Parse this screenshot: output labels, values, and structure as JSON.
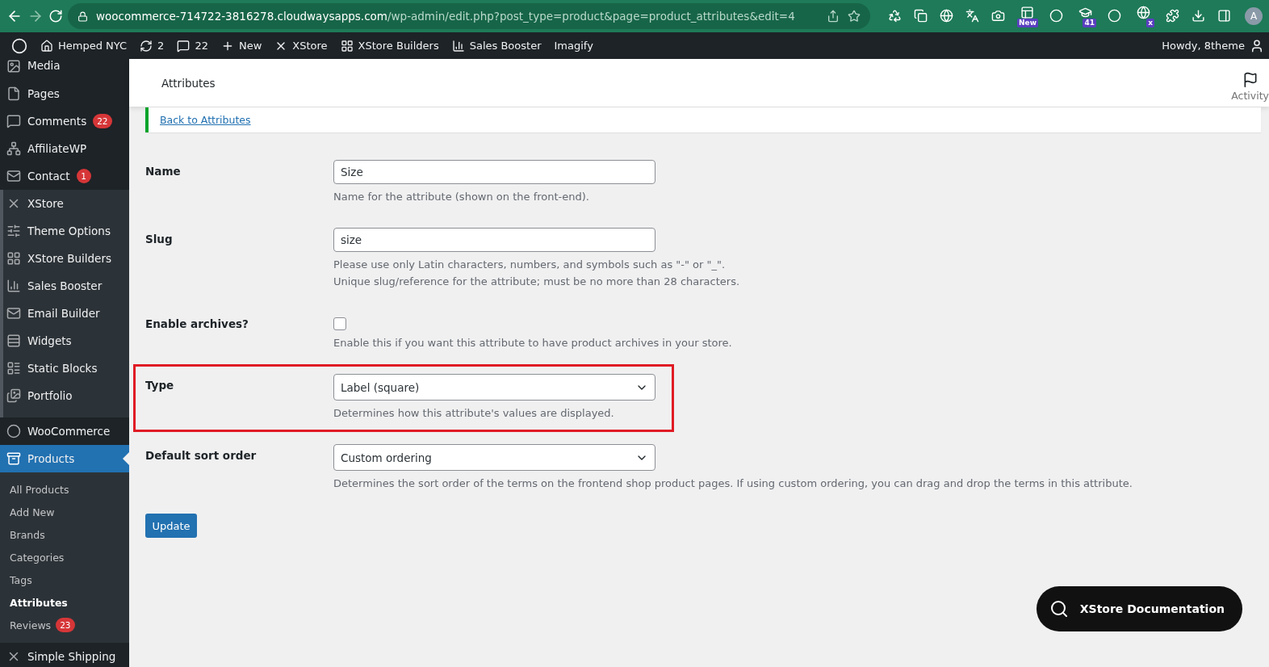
{
  "browser": {
    "url_host": "woocommerce-714722-3816278.cloudwaysapps.com",
    "url_path": "/wp-admin/edit.php?post_type=product&page=product_attributes&edit=4",
    "extensions": [
      {
        "kind": "plain"
      },
      {
        "kind": "plain"
      },
      {
        "kind": "plain"
      },
      {
        "kind": "plain"
      },
      {
        "kind": "plain"
      },
      {
        "kind": "badge",
        "badge": "New"
      },
      {
        "kind": "plain"
      },
      {
        "kind": "badge",
        "badge": "41"
      },
      {
        "kind": "plain"
      },
      {
        "kind": "badge",
        "badge": "x"
      },
      {
        "kind": "plain"
      },
      {
        "kind": "plain"
      },
      {
        "kind": "plain"
      }
    ],
    "profile": "A"
  },
  "admin_bar": {
    "items": [
      {
        "label": "Hemped NYC"
      },
      {
        "label": "2"
      },
      {
        "label": "22"
      },
      {
        "label": "New"
      },
      {
        "label": "XStore"
      },
      {
        "label": "XStore Builders"
      },
      {
        "label": "Sales Booster"
      },
      {
        "label": "Imagify"
      }
    ],
    "greeting": "Howdy, 8theme"
  },
  "sidebar": {
    "groups": [
      {
        "kind": "core",
        "items": [
          {
            "label": "Media",
            "selected": false
          },
          {
            "label": "Pages",
            "selected": false
          },
          {
            "label": "Comments",
            "badge": "22",
            "selected": false
          },
          {
            "label": "AffiliateWP",
            "selected": false
          },
          {
            "label": "Contact",
            "badge": "1",
            "selected": false
          }
        ]
      },
      {
        "kind": "plugin",
        "items": [
          {
            "label": "XStore",
            "selected": false
          },
          {
            "label": "Theme Options",
            "selected": false
          },
          {
            "label": "XStore Builders",
            "selected": false
          },
          {
            "label": "Sales Booster",
            "selected": false
          },
          {
            "label": "Email Builder",
            "selected": false
          },
          {
            "label": "Widgets",
            "selected": false
          },
          {
            "label": "Static Blocks",
            "selected": false
          },
          {
            "label": "Portfolio",
            "selected": false
          }
        ]
      },
      {
        "kind": "core",
        "items": [
          {
            "label": "WooCommerce",
            "selected": false
          },
          {
            "label": "Products",
            "selected": true,
            "children": [
              {
                "label": "All Products",
                "selected": false
              },
              {
                "label": "Add New",
                "selected": false
              },
              {
                "label": "Brands",
                "selected": false
              },
              {
                "label": "Categories",
                "selected": false
              },
              {
                "label": "Tags",
                "selected": false
              },
              {
                "label": "Attributes",
                "selected": true
              },
              {
                "label": "Reviews",
                "badge": "23",
                "selected": false
              }
            ]
          },
          {
            "label": "Simple Shipping",
            "selected": false
          }
        ]
      }
    ]
  },
  "header": {
    "title": "Attributes",
    "activity": "Activity"
  },
  "notice": {
    "link": "Back to Attributes"
  },
  "form": {
    "rows": [
      {
        "kind": "text",
        "label": "Name",
        "value": "Size",
        "help": [
          "Name for the attribute (shown on the front-end)."
        ],
        "highlighted": false
      },
      {
        "kind": "text",
        "label": "Slug",
        "value": "size",
        "help": [
          "Please use only Latin characters, numbers, and symbols such as \"-\" or \"_\".",
          "Unique slug/reference for the attribute; must be no more than 28 characters."
        ],
        "highlighted": false
      },
      {
        "kind": "checkbox",
        "label": "Enable archives?",
        "checked": false,
        "help": [
          "Enable this if you want this attribute to have product archives in your store."
        ],
        "highlighted": false
      },
      {
        "kind": "select",
        "label": "Type",
        "value": "Label (square)",
        "help": [
          "Determines how this attribute's values are displayed."
        ],
        "highlighted": true
      },
      {
        "kind": "select",
        "label": "Default sort order",
        "value": "Custom ordering",
        "help": [
          "Determines the sort order of the terms on the frontend shop product pages. If using custom ordering, you can drag and drop the terms in this attribute."
        ],
        "highlighted": false
      }
    ],
    "submit": "Update"
  },
  "doc_button": {
    "label": "XStore Documentation"
  }
}
